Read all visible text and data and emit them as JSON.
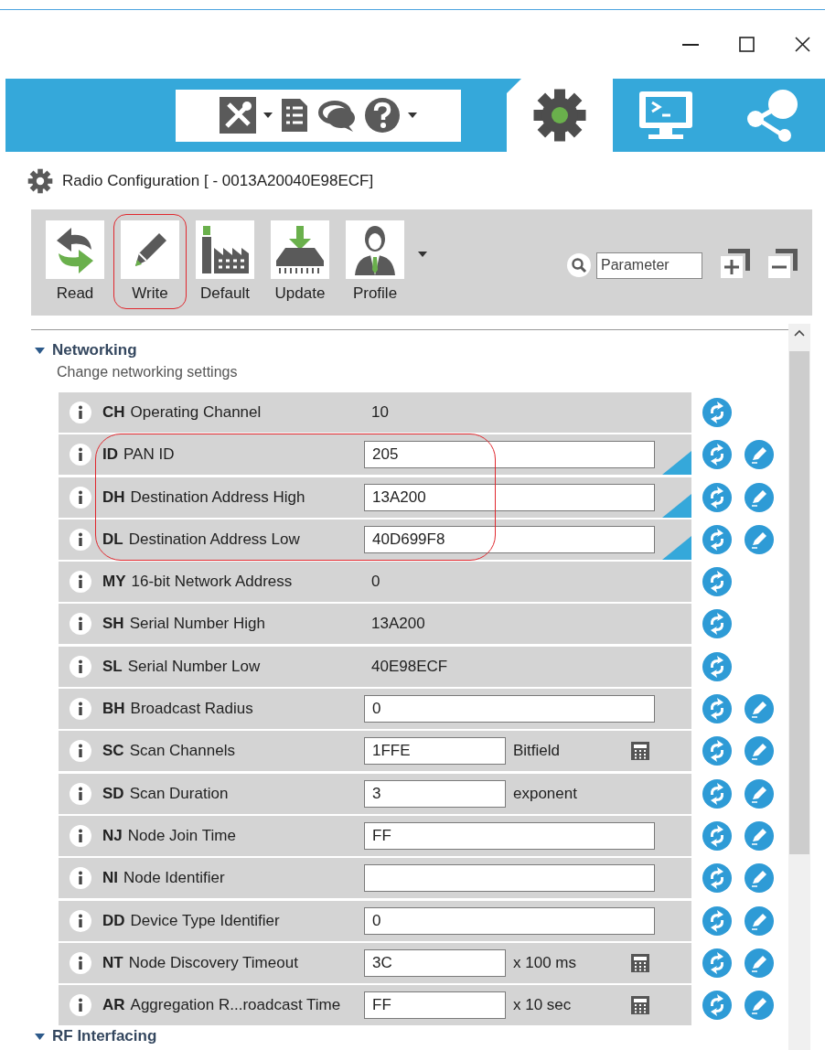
{
  "tabs": [
    {
      "kind": "configuration",
      "selected": true
    },
    {
      "kind": "console",
      "selected": false
    },
    {
      "kind": "network",
      "selected": false
    }
  ],
  "panel": {
    "title": "Radio Configuration [ - 0013A20040E98ECF]"
  },
  "toolbar": {
    "buttons": [
      {
        "kind": "read",
        "label": "Read",
        "circled": false,
        "dropdown": false
      },
      {
        "kind": "write",
        "label": "Write",
        "circled": true,
        "dropdown": false
      },
      {
        "kind": "default",
        "label": "Default",
        "circled": false,
        "dropdown": false
      },
      {
        "kind": "update",
        "label": "Update",
        "circled": false,
        "dropdown": false
      },
      {
        "kind": "profile",
        "label": "Profile",
        "circled": false,
        "dropdown": true
      }
    ],
    "search": {
      "placeholder": "Parameter"
    }
  },
  "sections": [
    {
      "title": "Networking",
      "description": "Change networking settings",
      "expanded": true,
      "rows": [
        {
          "kind": "readonly",
          "code": "CH",
          "label": "Operating Channel",
          "value": "10",
          "modified": false,
          "circled": false
        },
        {
          "kind": "field",
          "code": "ID",
          "label": "PAN ID",
          "value": "205",
          "modified": true,
          "circled": true
        },
        {
          "kind": "field",
          "code": "DH",
          "label": "Destination Address High",
          "value": "13A200",
          "modified": true,
          "circled": true
        },
        {
          "kind": "field",
          "code": "DL",
          "label": "Destination Address Low",
          "value": "40D699F8",
          "modified": true,
          "circled": true
        },
        {
          "kind": "readonly",
          "code": "MY",
          "label": "16-bit Network Address",
          "value": "0",
          "modified": false,
          "circled": false
        },
        {
          "kind": "readonly",
          "code": "SH",
          "label": "Serial Number High",
          "value": "13A200",
          "modified": false,
          "circled": false
        },
        {
          "kind": "readonly",
          "code": "SL",
          "label": "Serial Number Low",
          "value": "40E98ECF",
          "modified": false,
          "circled": false
        },
        {
          "kind": "field",
          "code": "BH",
          "label": "Broadcast Radius",
          "value": "0",
          "modified": false,
          "circled": false
        },
        {
          "kind": "field_unit",
          "code": "SC",
          "label": "Scan Channels",
          "value": "1FFE",
          "unit": "Bitfield",
          "calculator": true,
          "modified": false,
          "circled": false
        },
        {
          "kind": "field_unit",
          "code": "SD",
          "label": "Scan Duration",
          "value": "3",
          "unit": "exponent",
          "calculator": false,
          "modified": false,
          "circled": false
        },
        {
          "kind": "field",
          "code": "NJ",
          "label": "Node Join Time",
          "value": "FF",
          "modified": false,
          "circled": false
        },
        {
          "kind": "field",
          "code": "NI",
          "label": "Node Identifier",
          "modified": false,
          "circled": false
        },
        {
          "kind": "field",
          "code": "DD",
          "label": "Device Type Identifier",
          "value": "0",
          "modified": false,
          "circled": false
        },
        {
          "kind": "field_unit",
          "code": "NT",
          "label": "Node Discovery Timeout",
          "value": "3C",
          "unit": "x 100 ms",
          "calculator": true,
          "modified": false,
          "circled": false
        },
        {
          "kind": "field_unit",
          "code": "AR",
          "label": "Aggregation R...roadcast Time",
          "value": "FF",
          "unit": "x 10 sec",
          "calculator": true,
          "modified": false,
          "circled": false
        }
      ]
    },
    {
      "title": "RF Interfacing",
      "expanded": true
    }
  ]
}
